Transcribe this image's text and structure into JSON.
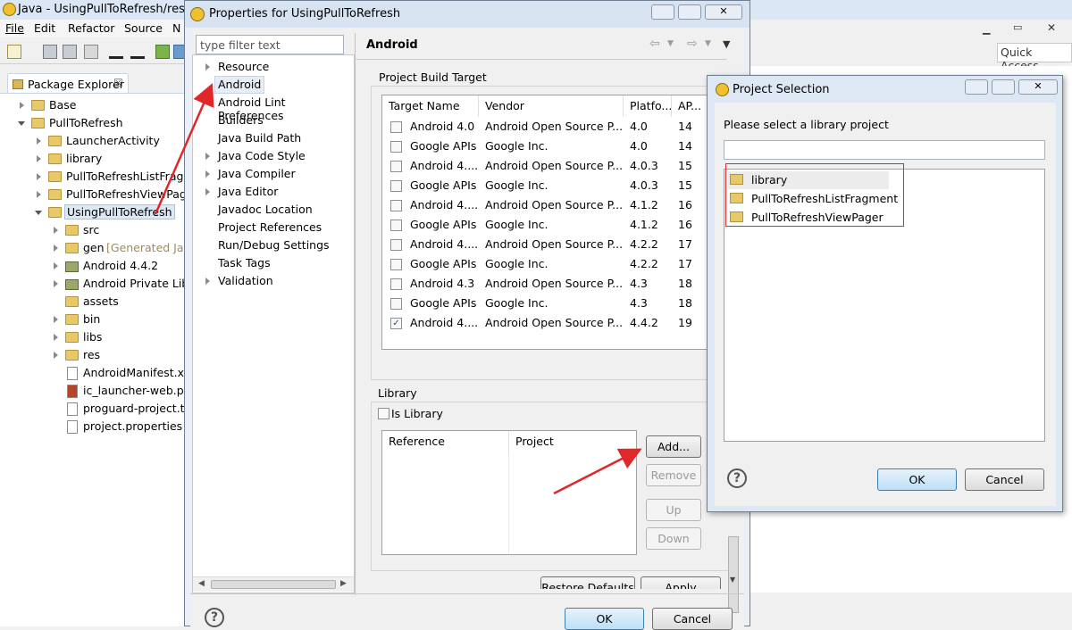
{
  "eclipse": {
    "title": "Java - UsingPullToRefresh/res/la",
    "menu": [
      "File",
      "Edit",
      "Refactor",
      "Source",
      "N"
    ],
    "quick_access": "Quick Access",
    "package_explorer": {
      "tab_label": "Package Explorer",
      "tab_close": "☒",
      "items": [
        {
          "label": "Base"
        },
        {
          "label": "PullToRefresh"
        },
        {
          "label": "LauncherActivity"
        },
        {
          "label": "library"
        },
        {
          "label": "PullToRefreshListFragn"
        },
        {
          "label": "PullToRefreshViewPage"
        },
        {
          "label": "UsingPullToRefresh"
        },
        {
          "label": "src"
        },
        {
          "label": "gen",
          "suffix": "[Generated Jav"
        },
        {
          "label": "Android 4.4.2"
        },
        {
          "label": "Android Private Lib"
        },
        {
          "label": "assets"
        },
        {
          "label": "bin"
        },
        {
          "label": "libs"
        },
        {
          "label": "res"
        },
        {
          "label": "AndroidManifest.xr"
        },
        {
          "label": "ic_launcher-web.pn"
        },
        {
          "label": "proguard-project.t"
        },
        {
          "label": "project.properties"
        }
      ]
    }
  },
  "properties_dialog": {
    "title": "Properties for UsingPullToRefresh",
    "filter_placeholder": "type filter text",
    "nav": [
      {
        "label": "Resource",
        "expandable": true
      },
      {
        "label": "Android",
        "selected": true
      },
      {
        "label": "Android Lint Preferences"
      },
      {
        "label": "Builders"
      },
      {
        "label": "Java Build Path"
      },
      {
        "label": "Java Code Style",
        "expandable": true
      },
      {
        "label": "Java Compiler",
        "expandable": true
      },
      {
        "label": "Java Editor",
        "expandable": true
      },
      {
        "label": "Javadoc Location"
      },
      {
        "label": "Project References"
      },
      {
        "label": "Run/Debug Settings"
      },
      {
        "label": "Task Tags"
      },
      {
        "label": "Validation",
        "expandable": true
      }
    ],
    "page_title": "Android",
    "build_target": {
      "label": "Project Build Target",
      "columns": [
        "Target Name",
        "Vendor",
        "Platfo...",
        "AP..."
      ],
      "rows": [
        {
          "name": "Android 4.0",
          "vendor": "Android Open Source P...",
          "platform": "4.0",
          "api": "14",
          "checked": false
        },
        {
          "name": "Google APIs",
          "vendor": "Google Inc.",
          "platform": "4.0",
          "api": "14",
          "checked": false
        },
        {
          "name": "Android 4....",
          "vendor": "Android Open Source P...",
          "platform": "4.0.3",
          "api": "15",
          "checked": false
        },
        {
          "name": "Google APIs",
          "vendor": "Google Inc.",
          "platform": "4.0.3",
          "api": "15",
          "checked": false
        },
        {
          "name": "Android 4....",
          "vendor": "Android Open Source P...",
          "platform": "4.1.2",
          "api": "16",
          "checked": false
        },
        {
          "name": "Google APIs",
          "vendor": "Google Inc.",
          "platform": "4.1.2",
          "api": "16",
          "checked": false
        },
        {
          "name": "Android 4....",
          "vendor": "Android Open Source P...",
          "platform": "4.2.2",
          "api": "17",
          "checked": false
        },
        {
          "name": "Google APIs",
          "vendor": "Google Inc.",
          "platform": "4.2.2",
          "api": "17",
          "checked": false
        },
        {
          "name": "Android 4.3",
          "vendor": "Android Open Source P...",
          "platform": "4.3",
          "api": "18",
          "checked": false
        },
        {
          "name": "Google APIs",
          "vendor": "Google Inc.",
          "platform": "4.3",
          "api": "18",
          "checked": false
        },
        {
          "name": "Android 4....",
          "vendor": "Android Open Source P...",
          "platform": "4.4.2",
          "api": "19",
          "checked": true
        }
      ]
    },
    "library": {
      "label": "Library",
      "is_library": "Is Library",
      "columns": [
        "Reference",
        "Project"
      ],
      "buttons": {
        "add": "Add...",
        "remove": "Remove",
        "up": "Up",
        "down": "Down"
      }
    },
    "restore_defaults": "Restore Defaults",
    "apply": "Apply",
    "ok": "OK",
    "cancel": "Cancel",
    "help": "?"
  },
  "project_selection": {
    "title": "Project Selection",
    "prompt": "Please select a library project",
    "filter_value": "",
    "projects": [
      "library",
      "PullToRefreshListFragment",
      "PullToRefreshViewPager"
    ],
    "ok": "OK",
    "cancel": "Cancel",
    "help": "?"
  },
  "colors": {
    "annotation": "#e0282a",
    "selection": "#dde8f5"
  }
}
